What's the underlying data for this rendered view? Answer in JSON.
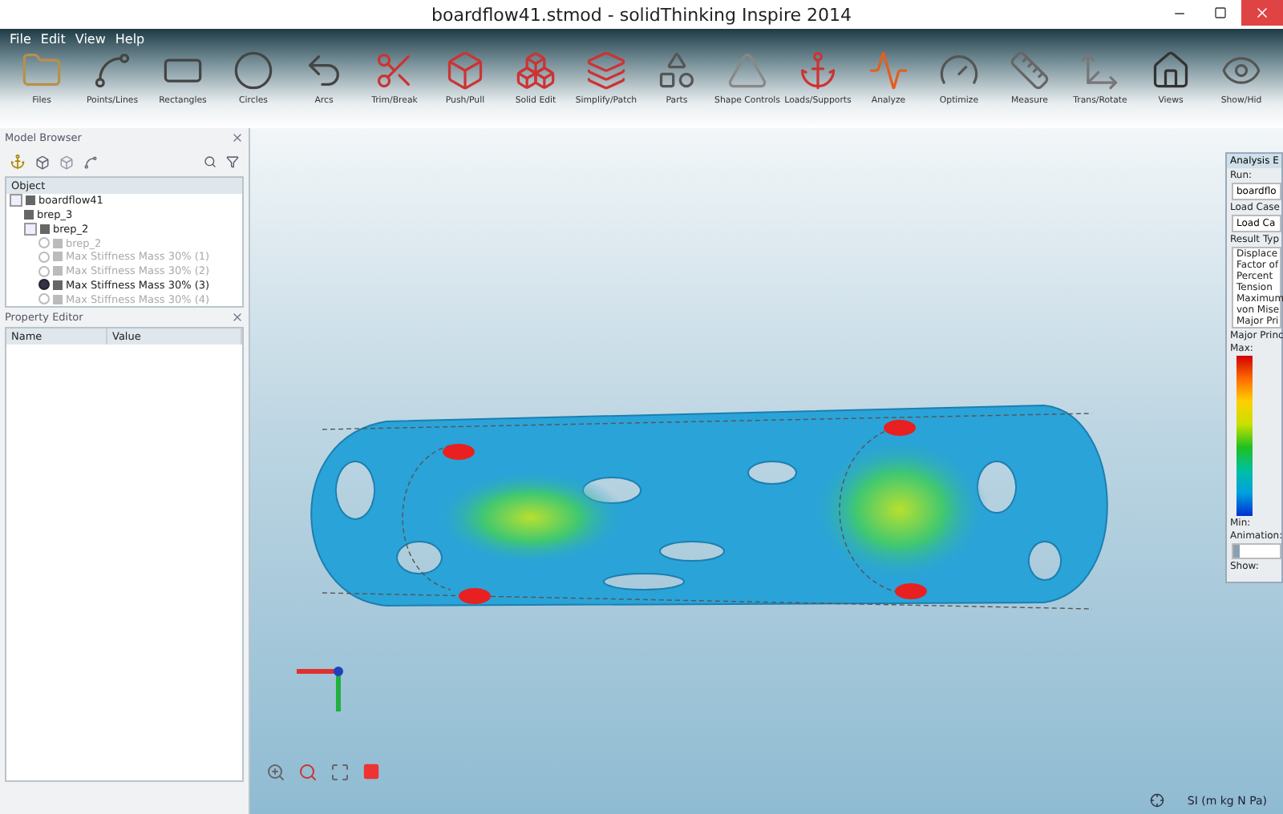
{
  "window": {
    "title": "boardflow41.stmod - solidThinking Inspire 2014"
  },
  "menu": [
    "File",
    "Edit",
    "View",
    "Help"
  ],
  "toolbar": [
    {
      "label": "Files"
    },
    {
      "label": "Points/Lines"
    },
    {
      "label": "Rectangles"
    },
    {
      "label": "Circles"
    },
    {
      "label": "Arcs"
    },
    {
      "label": "Trim/Break"
    },
    {
      "label": "Push/Pull"
    },
    {
      "label": "Solid Edit"
    },
    {
      "label": "Simplify/Patch"
    },
    {
      "label": "Parts"
    },
    {
      "label": "Shape Controls"
    },
    {
      "label": "Loads/Supports"
    },
    {
      "label": "Analyze"
    },
    {
      "label": "Optimize"
    },
    {
      "label": "Measure"
    },
    {
      "label": "Trans/Rotate"
    },
    {
      "label": "Views"
    },
    {
      "label": "Show/Hid"
    }
  ],
  "model_browser": {
    "title": "Model Browser",
    "column": "Object",
    "tree": [
      {
        "label": "boardflow41",
        "expanded": true,
        "children": [
          {
            "label": "brep_3",
            "disabled": false
          },
          {
            "label": "brep_2",
            "expanded": true,
            "children": [
              {
                "label": "brep_2",
                "disabled": true,
                "selected": false
              },
              {
                "label": "Max Stiffness Mass 30% (1)",
                "disabled": true,
                "selected": false
              },
              {
                "label": "Max Stiffness Mass 30% (2)",
                "disabled": true,
                "selected": false
              },
              {
                "label": "Max Stiffness Mass 30% (3)",
                "disabled": false,
                "selected": true
              },
              {
                "label": "Max Stiffness Mass 30% (4)",
                "disabled": true,
                "selected": false
              }
            ]
          }
        ]
      }
    ]
  },
  "property_editor": {
    "title": "Property Editor",
    "columns": [
      "Name",
      "Value"
    ]
  },
  "analysis_panel": {
    "title": "Analysis E",
    "run_label": "Run:",
    "run_value": "boardflo",
    "load_case_label": "Load Case",
    "load_case_value": "Load Ca",
    "result_type_label": "Result Typ",
    "result_types": [
      "Displace",
      "Factor of",
      "Percent",
      "Tension",
      "Maximum",
      "von Mise",
      "Major Pri"
    ],
    "legend_title": "Major Princ",
    "max_label": "Max:",
    "min_label": "Min:",
    "animation_label": "Animation:",
    "animation": {
      "level": 0
    },
    "show_label": "Show:"
  },
  "status_bar": {
    "units": "SI (m kg N Pa)"
  }
}
